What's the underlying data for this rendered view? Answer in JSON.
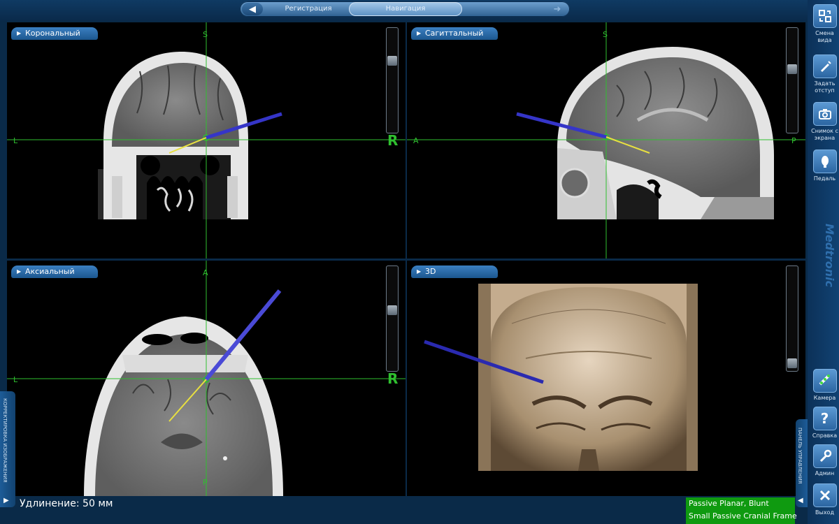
{
  "topnav": {
    "back_icon": "arrow-left-icon",
    "forward_icon": "arrow-right-icon",
    "tabs": [
      {
        "label": "Регистрация",
        "active": false
      },
      {
        "label": "Навигация",
        "active": true
      }
    ]
  },
  "viewports": {
    "coronal": {
      "label": "Корональный",
      "top": "S",
      "left": "L",
      "right": "R"
    },
    "sagittal": {
      "label": "Сагиттальный",
      "top": "S",
      "left": "A",
      "right": "P"
    },
    "axial": {
      "label": "Аксиальный",
      "top": "A",
      "left": "L",
      "right": "R",
      "bottom": "P"
    },
    "view3d": {
      "label": "3D"
    }
  },
  "sidebar": {
    "items": [
      {
        "label": "Смена вида",
        "icon": "layout-switch-icon"
      },
      {
        "label": "Задать отступ",
        "icon": "pen-offset-icon"
      },
      {
        "label": "Снимок с экрана",
        "icon": "camera-icon"
      },
      {
        "label": "Педаль",
        "icon": "footswitch-icon"
      },
      {
        "label": "Камера",
        "icon": "tracking-camera-icon"
      },
      {
        "label": "Справка",
        "icon": "help-icon"
      },
      {
        "label": "Админ",
        "icon": "wrench-icon"
      },
      {
        "label": "Выход",
        "icon": "close-icon"
      }
    ],
    "brand": "Medtronic"
  },
  "left_tab": {
    "label": "КОРРЕКТИРОВКА ИЗОБРАЖЕНИЯ"
  },
  "right_tab": {
    "label": "ПАНЕЛЬ УПРАВЛЕНИЯ"
  },
  "status": {
    "extension": "Удлинение: 50 мм"
  },
  "instrument": {
    "line1": "Passive Planar, Blunt",
    "line2": "Small Passive Cranial Frame"
  },
  "colors": {
    "crosshair": "#2fbf2f",
    "probe": "#3535c8",
    "trajectory": "#e8e040",
    "instrument_bg": "#0f9a10"
  }
}
